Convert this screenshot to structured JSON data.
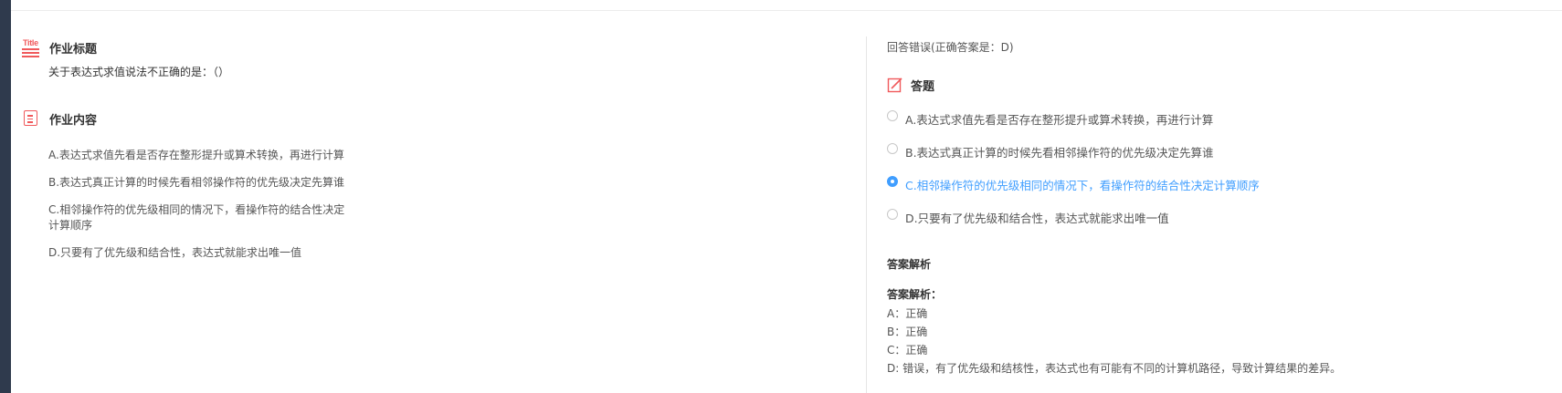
{
  "left": {
    "title_section": {
      "heading": "作业标题",
      "question": "关于表达式求值说法不正确的是：（）",
      "icon_text": "Title"
    },
    "content_section": {
      "heading": "作业内容",
      "options": [
        "A.表达式求值先看是否存在整形提升或算术转换，再进行计算",
        "B.表达式真正计算的时候先看相邻操作符的优先级决定先算谁",
        "C.相邻操作符的优先级相同的情况下，看操作符的结合性决定",
        "计算顺序",
        "D.只要有了优先级和结合性，表达式就能求出唯一值"
      ]
    }
  },
  "right": {
    "result_text": "回答错误(正确答案是：D)",
    "answer_heading": "答题",
    "choices": [
      {
        "label": "A.表达式求值先看是否存在整形提升或算术转换，再进行计算",
        "selected": false
      },
      {
        "label": "B.表达式真正计算的时候先看相邻操作符的优先级决定先算谁",
        "selected": false
      },
      {
        "label": "C.相邻操作符的优先级相同的情况下，看操作符的结合性决定计算顺序",
        "selected": true
      },
      {
        "label": "D.只要有了优先级和结合性，表达式就能求出唯一值",
        "selected": false
      }
    ],
    "analysis_heading": "答案解析",
    "analysis": {
      "title": "答案解析：",
      "lines": [
        "A：正确",
        "B：正确",
        "C：正确",
        "D: 错误，有了优先级和结核性，表达式也有可能有不同的计算机路径，导致计算结果的差异。"
      ]
    }
  },
  "colors": {
    "accent": "#409eff",
    "icon": "#f0595b",
    "sidebar": "#2f3a4d"
  }
}
